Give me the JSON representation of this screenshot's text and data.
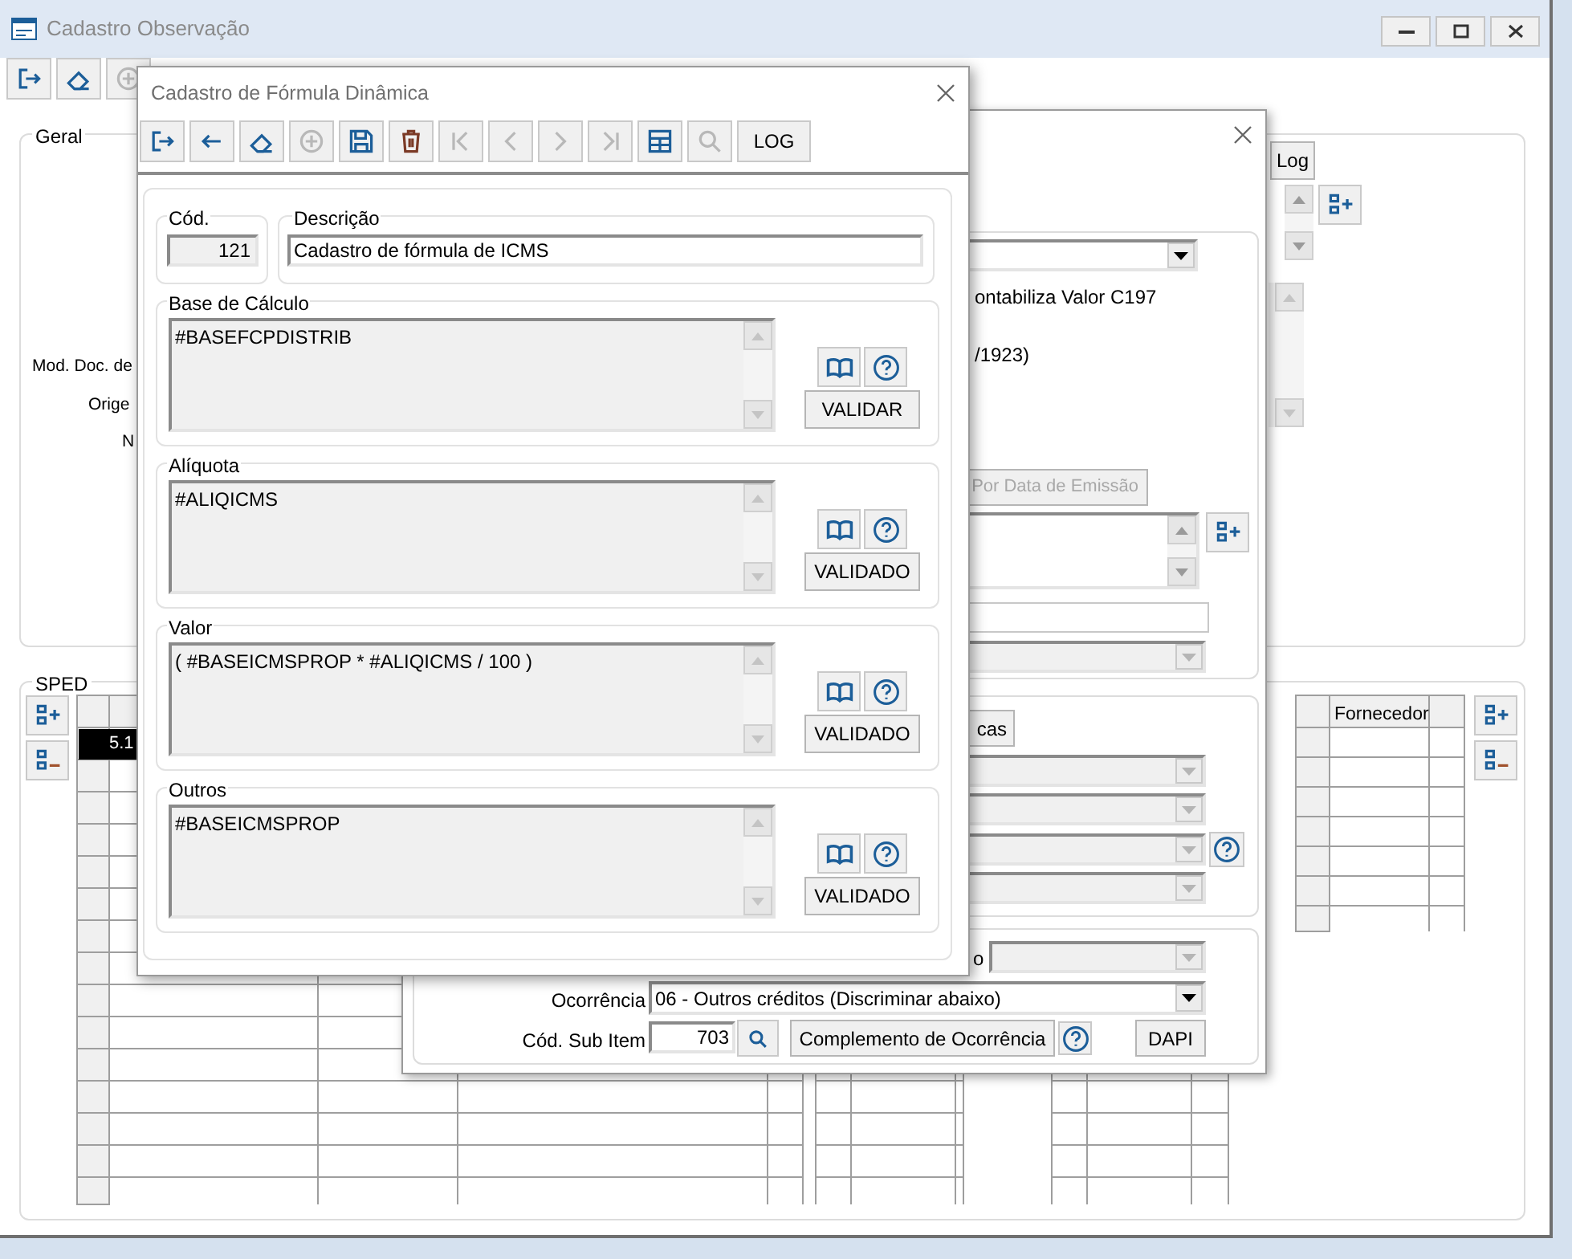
{
  "main_window": {
    "title": "Cadastro Observação",
    "toolbar": [
      {
        "kind": "exit",
        "disabled": false
      },
      {
        "kind": "eraser",
        "disabled": false
      },
      {
        "kind": "add",
        "disabled": true
      }
    ],
    "geral": {
      "legend": "Geral",
      "labels": [
        "Mod. Doc. de",
        "Orige",
        "N"
      ],
      "log_button": "Log"
    },
    "sped": {
      "legend": "SPED",
      "rows": [
        {
          "cell": "5.1",
          "selected": true
        }
      ]
    },
    "supplier_grid": {
      "header": "Fornecedor"
    }
  },
  "middle_window": {
    "texts": [
      "ontabiliza Valor C197",
      "/1923)"
    ],
    "date_button": {
      "label": "Por Data de Emissão",
      "disabled": true
    },
    "tab_button": "cas",
    "cut_label": "o",
    "ocorrencia": {
      "label": "Ocorrência",
      "value": "06 - Outros créditos (Discriminar abaixo)"
    },
    "sub_item": {
      "label": "Cód. Sub Item",
      "value": "703"
    },
    "complemento_button": "Complemento de Ocorrência",
    "dapi_button": "DAPI"
  },
  "dialog": {
    "title": "Cadastro de Fórmula Dinâmica",
    "toolbar": [
      {
        "kind": "exit",
        "disabled": false
      },
      {
        "kind": "back",
        "disabled": false
      },
      {
        "kind": "eraser",
        "disabled": false
      },
      {
        "kind": "add",
        "disabled": true
      },
      {
        "kind": "save",
        "disabled": false
      },
      {
        "kind": "delete",
        "disabled": false
      },
      {
        "kind": "first",
        "disabled": true
      },
      {
        "kind": "prev",
        "disabled": true
      },
      {
        "kind": "next",
        "disabled": true
      },
      {
        "kind": "last",
        "disabled": true
      },
      {
        "kind": "table",
        "disabled": false
      },
      {
        "kind": "search",
        "disabled": true
      }
    ],
    "log_button": "LOG",
    "codigo": {
      "label": "Cód.",
      "value": "121"
    },
    "descricao": {
      "label": "Descrição",
      "value": "Cadastro de fórmula de ICMS"
    },
    "formulas": [
      {
        "label": "Base de Cálculo",
        "text": "#BASEFCPDISTRIB",
        "button": "VALIDAR"
      },
      {
        "label": "Alíquota",
        "text": "#ALIQICMS",
        "button": "VALIDADO"
      },
      {
        "label": "Valor",
        "text": "( #BASEICMSPROP * #ALIQICMS / 100 )",
        "button": "VALIDADO"
      },
      {
        "label": "Outros",
        "text": "#BASEICMSPROP",
        "button": "VALIDADO"
      }
    ]
  }
}
